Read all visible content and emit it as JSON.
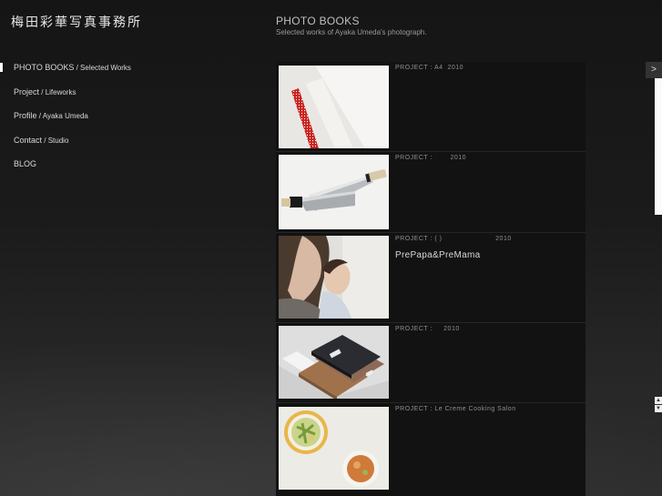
{
  "site": {
    "logo": "梅田彩華写真事務所"
  },
  "nav": {
    "items": [
      {
        "main": "PHOTO BOOKS",
        "sep": " / ",
        "sub": "Selected Works"
      },
      {
        "main": "Project",
        "sep": " / ",
        "sub": "Lifeworks"
      },
      {
        "main": "Profile",
        "sep": " / ",
        "sub": "Ayaka Umeda"
      },
      {
        "main": "Contact",
        "sep": " / ",
        "sub": "Studio"
      },
      {
        "main": "BLOG",
        "sep": "",
        "sub": ""
      }
    ]
  },
  "header": {
    "title": "PHOTO BOOKS",
    "subtitle": "Selected works of Ayaka Umeda's photograph."
  },
  "projects": [
    {
      "meta": "PROJECT : A4  2010",
      "title": ""
    },
    {
      "meta": "PROJECT :        2010",
      "title": ""
    },
    {
      "meta": "PROJECT : ( )                        2010",
      "title": "PrePapa&PreMama"
    },
    {
      "meta": "PROJECT :     2010",
      "title": ""
    },
    {
      "meta": "PROJECT : Le Creme Cooking Salon",
      "title": ""
    }
  ],
  "ui": {
    "scroll_right": ">",
    "scroll_up": "▲",
    "scroll_down": "▼"
  },
  "colors": {
    "background": "#1b1b1b",
    "panel": "#121212",
    "text": "#d8d8d8"
  }
}
